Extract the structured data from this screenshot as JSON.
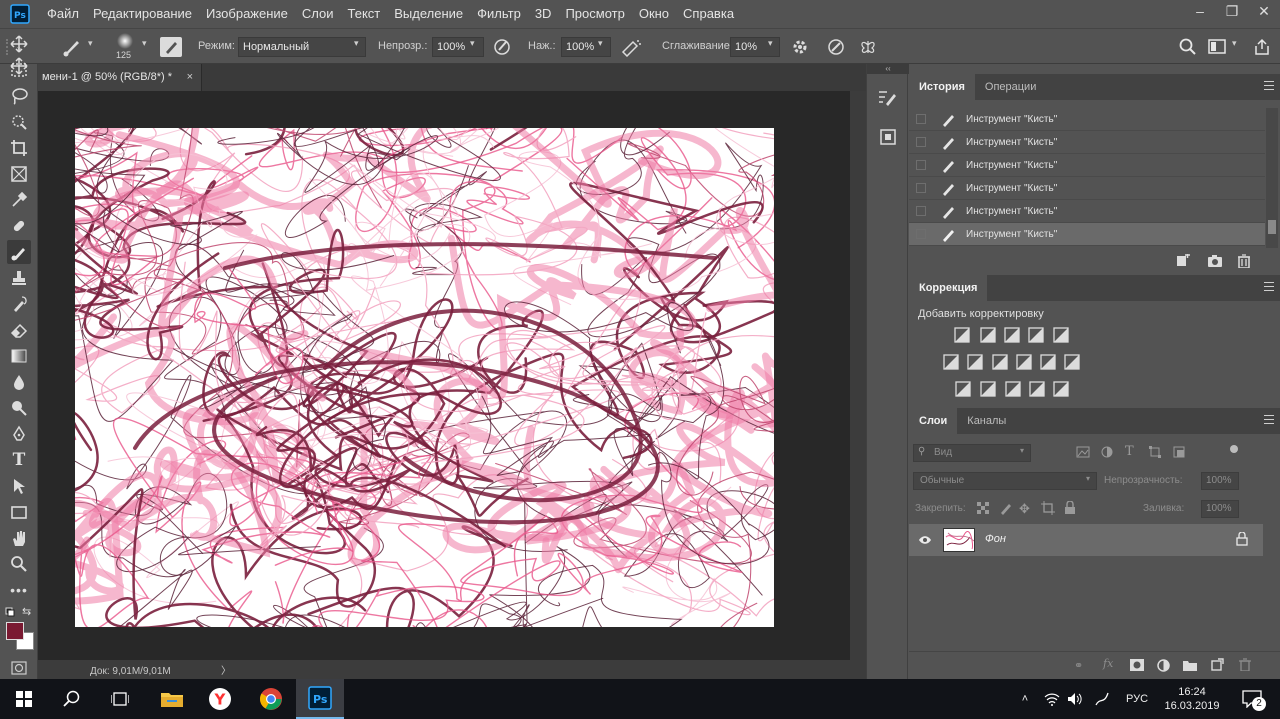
{
  "menubar": {
    "items": [
      "Файл",
      "Редактирование",
      "Изображение",
      "Слои",
      "Текст",
      "Выделение",
      "Фильтр",
      "3D",
      "Просмотр",
      "Окно",
      "Справка"
    ]
  },
  "options": {
    "brush_size": "125",
    "mode_label": "Режим:",
    "mode_value": "Нормальный",
    "opacity_label": "Непрозр.:",
    "opacity_value": "100%",
    "pressure_label": "Наж.:",
    "pressure_value": "100%",
    "smoothing_label": "Сглаживание:",
    "smoothing_value": "10%"
  },
  "document": {
    "tab_title": "мени-1 @ 50% (RGB/8*) *",
    "status": "Док: 9,01M/9,01M",
    "status_arrow": "〉"
  },
  "history_panel": {
    "tabs": [
      "История",
      "Операции"
    ],
    "items": [
      "Инструмент \"Кисть\"",
      "Инструмент \"Кисть\"",
      "Инструмент \"Кисть\"",
      "Инструмент \"Кисть\"",
      "Инструмент \"Кисть\"",
      "Инструмент \"Кисть\""
    ]
  },
  "correction_panel": {
    "tab": "Коррекция",
    "add_label": "Добавить корректировку"
  },
  "layers_panel": {
    "tabs": [
      "Слои",
      "Каналы"
    ],
    "search_placeholder": "Вид",
    "blend_mode": "Обычные",
    "opacity_label": "Непрозрачность:",
    "opacity_value": "100%",
    "lock_label": "Закрепить:",
    "fill_label": "Заливка:",
    "fill_value": "100%",
    "layer_name": "Фон"
  },
  "taskbar": {
    "lang": "РУС",
    "time": "16:24",
    "date": "16.03.2019",
    "notifications": "2"
  },
  "colors": {
    "accent_pink": "#e8558a",
    "dark_wine": "#7a1f3d",
    "foreground": "#7a1a32",
    "background": "#ffffff"
  }
}
